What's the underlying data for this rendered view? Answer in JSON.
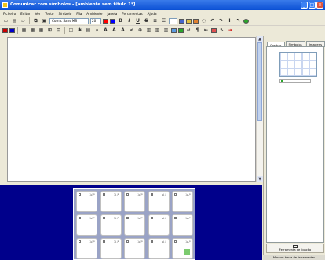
{
  "window": {
    "title": "Comunicar com símbolos - [ambiente sem título 1*]",
    "buttons": [
      "_",
      "□",
      "×"
    ]
  },
  "menu": [
    "Ficheiro",
    "Editar",
    "Ver",
    "Texto",
    "Símbolo",
    "Fila",
    "Ambiente",
    "Janela",
    "Ferramentas",
    "Ajuda"
  ],
  "toolbar": {
    "font_name": "Comic Sans MS",
    "font_size": "20",
    "bold": "B",
    "italic": "I",
    "underline": "U",
    "strike": "S"
  },
  "right_panel": {
    "tabs": [
      "Grelhas",
      "Símbolos",
      "Imagens"
    ],
    "active_tab": "Grelhas",
    "page_button_label": "Ferramenta de ligação",
    "bottom_bar_label": "Mostrar barra de ferramentas"
  },
  "colors": {
    "title_bar": "#0a4fd4",
    "board_background": "#00008b",
    "cell_border": "#c0c0c0",
    "accent_green": "#2aa52a"
  }
}
